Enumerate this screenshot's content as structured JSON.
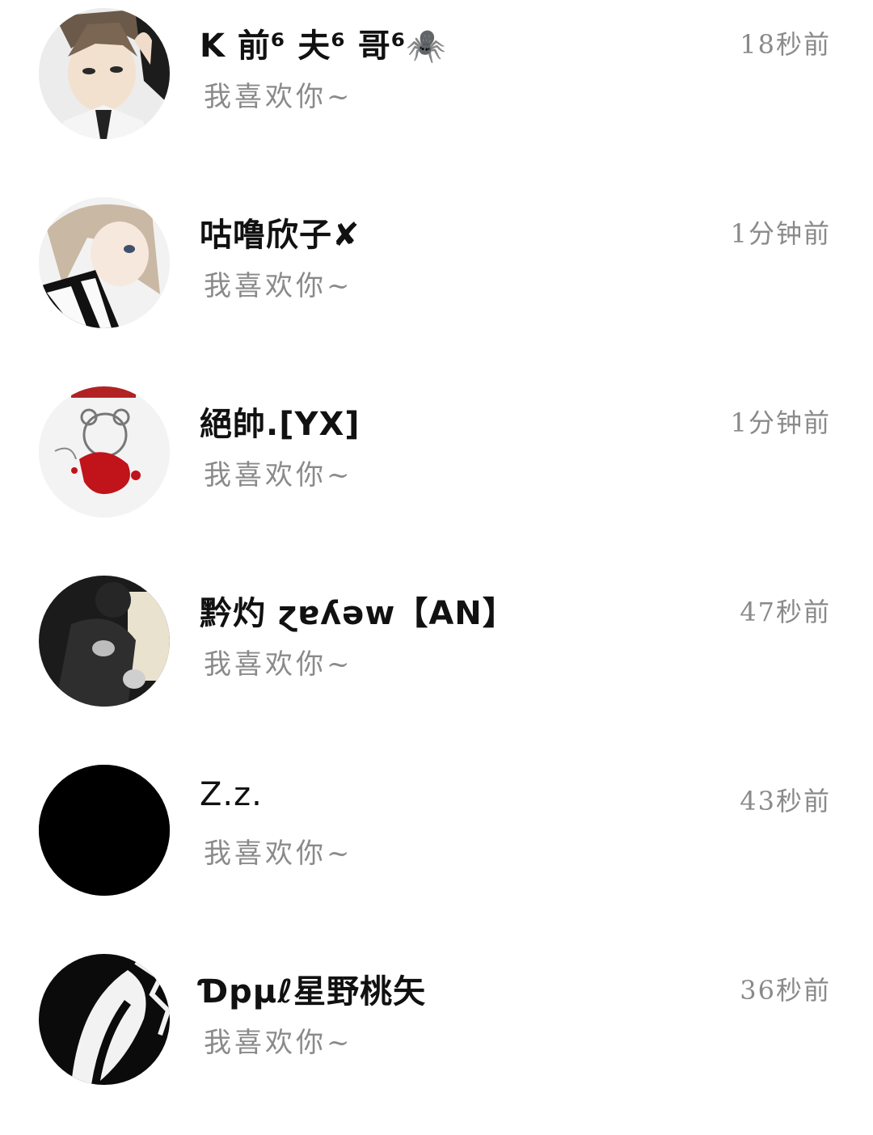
{
  "chats": [
    {
      "name": "K 前⁶ 夫⁶ 哥⁶🕷️",
      "preview": "我喜欢你~",
      "time": "18秒前",
      "avatar": "anime-boy-avatar"
    },
    {
      "name": "咕噜欣子✘",
      "preview": "我喜欢你~",
      "time": "1分钟前",
      "avatar": "anime-girl-avatar"
    },
    {
      "name": "絕帥.[YX]",
      "preview": "我喜欢你~",
      "time": "1分钟前",
      "avatar": "graffiti-bear-avatar"
    },
    {
      "name": "黔灼 ɀɐʎǝw【AN】",
      "preview": "我喜欢你~",
      "time": "47秒前",
      "avatar": "person-with-cat-avatar"
    },
    {
      "name": "Z.z.",
      "preview": "我喜欢你~",
      "time": "43秒前",
      "avatar": "black-avatar"
    },
    {
      "name": "Ɗpμℓ星野桃矢",
      "preview": "我喜欢你~",
      "time": "36秒前",
      "avatar": "abstract-bw-avatar"
    }
  ]
}
